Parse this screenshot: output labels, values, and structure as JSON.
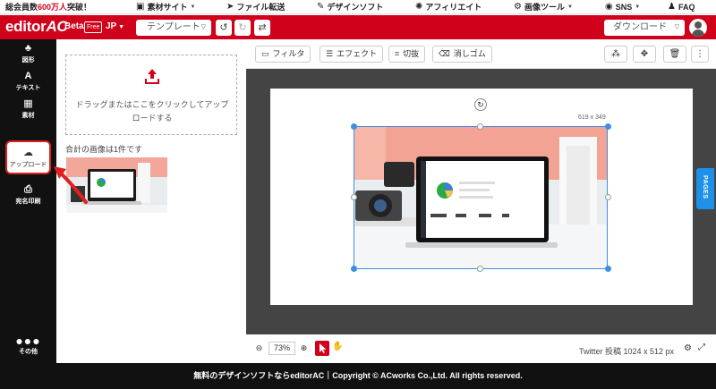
{
  "topbar": {
    "promo_prefix": "総会員数",
    "promo_highlight": "600万人",
    "promo_suffix": "突破！",
    "links": [
      {
        "label": "素材サイト",
        "icon": "image-icon"
      },
      {
        "label": "ファイル転送",
        "icon": "send-icon"
      },
      {
        "label": "デザインソフト",
        "icon": "brush-icon"
      },
      {
        "label": "アフィリエイト",
        "icon": "sparkle-icon"
      },
      {
        "label": "画像ツール",
        "icon": "settings-icon"
      },
      {
        "label": "SNS",
        "icon": "globe-icon"
      },
      {
        "label": "FAQ",
        "icon": "faq-icon"
      }
    ]
  },
  "header": {
    "logo_main": "editor",
    "logo_ac": "AC",
    "beta": "Beta",
    "free": "Free",
    "lang": "JP",
    "template_label": "テンプレート",
    "download_label": "ダウンロード",
    "brand_color": "#d0021b"
  },
  "sidebar": {
    "items": [
      {
        "label": "図形",
        "icon": "shapes-icon"
      },
      {
        "label": "テキスト",
        "icon": "text-icon"
      },
      {
        "label": "素材",
        "icon": "grid-icon"
      },
      {
        "label": "アップロード",
        "icon": "cloud-upload-icon"
      },
      {
        "label": "宛名印刷",
        "icon": "print-icon"
      }
    ],
    "more_label": "その他"
  },
  "panel": {
    "drop_text": "ドラッグまたはここをクリックしてアップロードする",
    "image_count": "合計の画像は1件です"
  },
  "toolbar": {
    "filter": "フィルタ",
    "effect": "エフェクト",
    "crop": "切抜",
    "eraser": "消しゴム"
  },
  "canvas": {
    "dimensions_label": "619 x 349",
    "pages_label": "PAGES"
  },
  "bottombar": {
    "zoom": "73%",
    "canvas_info": "Twitter 投稿 1024 x 512 px"
  },
  "footer": {
    "text": "無料のデザインソフトならeditorAC｜Copyright © ACworks Co.,Ltd. All rights reserved."
  },
  "colors": {
    "accent": "#d0021b",
    "selection": "#3b8fe5",
    "pages_tab": "#1e90e8"
  }
}
